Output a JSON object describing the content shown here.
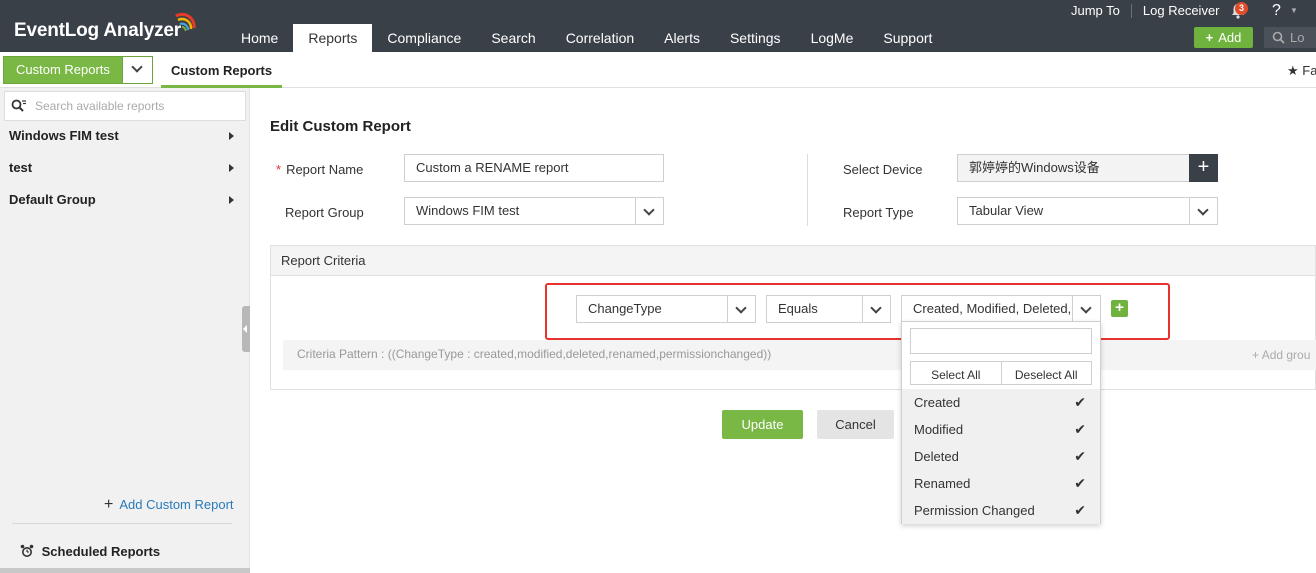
{
  "app": {
    "logo": "EventLog Analyzer"
  },
  "nav": [
    "Home",
    "Reports",
    "Compliance",
    "Search",
    "Correlation",
    "Alerts",
    "Settings",
    "LogMe",
    "Support"
  ],
  "active_nav": "Reports",
  "top_links": [
    "Jump To",
    "Log Receiver"
  ],
  "notifications": {
    "count": "3"
  },
  "help_label": "?",
  "add_button": "Add",
  "top_search_text": "Lo",
  "subbar": {
    "dropdown_label": "Custom Reports",
    "tab_label": "Custom Reports",
    "favorites_label": "Fa"
  },
  "sidebar": {
    "search_placeholder": "Search available reports",
    "groups": [
      "Windows FIM test",
      "test",
      "Default Group"
    ],
    "add_custom_report": "Add Custom Report",
    "scheduled_reports": "Scheduled Reports"
  },
  "form": {
    "title": "Edit Custom Report",
    "report_name_label": "Report Name",
    "report_name_value": "Custom a RENAME report",
    "report_group_label": "Report Group",
    "report_group_value": "Windows FIM test",
    "select_device_label": "Select Device",
    "select_device_value": "郭婷婷的Windows设备",
    "report_type_label": "Report Type",
    "report_type_value": "Tabular View"
  },
  "criteria": {
    "header": "Report Criteria",
    "field": "ChangeType",
    "operator": "Equals",
    "value": "Created, Modified, Deleted, R",
    "pattern": "Criteria Pattern : ((ChangeType : created,modified,deleted,renamed,permissionchanged))",
    "add_group": "Add grou"
  },
  "dropdown": {
    "select_all": "Select All",
    "deselect_all": "Deselect All",
    "options": [
      "Created",
      "Modified",
      "Deleted",
      "Renamed",
      "Permission Changed"
    ]
  },
  "buttons": {
    "update": "Update",
    "cancel": "Cancel"
  },
  "colors": {
    "accent_green": "#79b844",
    "topbar": "#3a4048",
    "highlight_red": "#e8322f"
  }
}
